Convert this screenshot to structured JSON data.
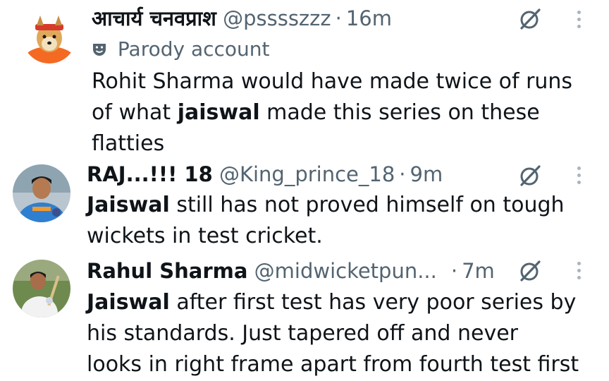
{
  "tweets": [
    {
      "author": "आचार्य चनवप्राश",
      "handle": "@psssszzz",
      "separator": "·",
      "time": "16m",
      "label_icon": "theater-masks-icon",
      "label": "Parody account",
      "body_lines": [
        {
          "parts": [
            {
              "text": "Rohit Sharma would have made twice of runs",
              "bold": false
            }
          ]
        },
        {
          "parts": [
            {
              "text": "of what ",
              "bold": false
            },
            {
              "text": "jaiswal",
              "bold": true
            },
            {
              "text": " made this series on these",
              "bold": false
            }
          ]
        },
        {
          "parts": [
            {
              "text": "flatties",
              "bold": false
            }
          ]
        }
      ]
    },
    {
      "author": "RAJ...!!! 18",
      "handle": "@King_prince_18",
      "separator": "·",
      "time": "9m",
      "body_lines": [
        {
          "parts": [
            {
              "text": "Jaiswal",
              "bold": true
            },
            {
              "text": " still has not proved himself on tough",
              "bold": false
            }
          ]
        },
        {
          "parts": [
            {
              "text": "wickets in test cricket.",
              "bold": false
            }
          ]
        }
      ]
    },
    {
      "author": "Rahul Sharma",
      "handle": "@midwicketpun...",
      "separator": "·",
      "time": "7m",
      "body_lines": [
        {
          "parts": [
            {
              "text": "Jaiswal",
              "bold": true
            },
            {
              "text": " after first test has very poor series by",
              "bold": false
            }
          ]
        },
        {
          "parts": [
            {
              "text": "his standards. Just tapered off and never",
              "bold": false
            }
          ]
        },
        {
          "parts": [
            {
              "text": "looks in right frame apart from fourth test first",
              "bold": false
            }
          ]
        }
      ]
    }
  ],
  "colors": {
    "muted": "#536471",
    "text": "#0f1419",
    "grok_icon": "#536471"
  }
}
